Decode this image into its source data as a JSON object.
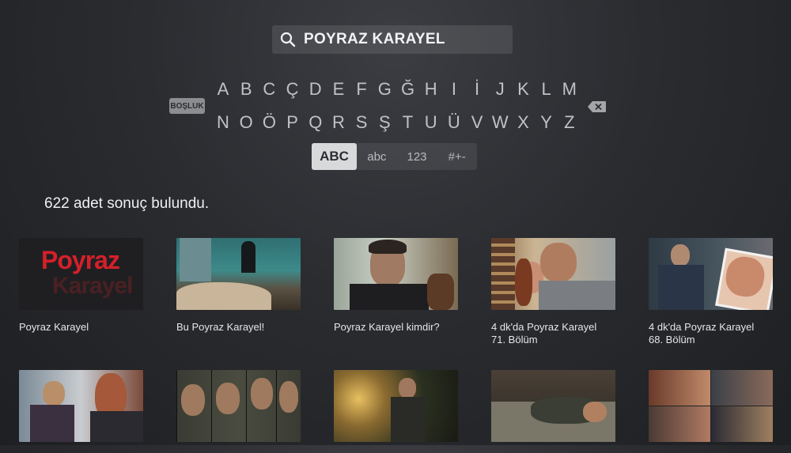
{
  "search": {
    "query": "POYRAZ KARAYEL"
  },
  "keyboard": {
    "row1": [
      "A",
      "B",
      "C",
      "Ç",
      "D",
      "E",
      "F",
      "G",
      "Ğ",
      "H",
      "I",
      "İ",
      "J",
      "K",
      "L",
      "M"
    ],
    "row2": [
      "N",
      "O",
      "Ö",
      "P",
      "Q",
      "R",
      "S",
      "Ş",
      "T",
      "U",
      "Ü",
      "V",
      "W",
      "X",
      "Y",
      "Z"
    ],
    "space_label": "BOŞLUK",
    "delete_icon": "backspace-icon",
    "modes": [
      {
        "label": "ABC",
        "active": true
      },
      {
        "label": "abc",
        "active": false
      },
      {
        "label": "123",
        "active": false
      },
      {
        "label": "#+-",
        "active": false
      }
    ]
  },
  "results": {
    "count_text": "622 adet sonuç bulundu.",
    "items": [
      {
        "title": "Poyraz Karayel",
        "logo_line1": "Poyraz",
        "logo_line2": "Karayel"
      },
      {
        "title": "Bu Poyraz Karayel!"
      },
      {
        "title": "Poyraz Karayel kimdir?"
      },
      {
        "title": "4 dk'da Poyraz Karayel\n71. Bölüm"
      },
      {
        "title": "4 dk'da Poyraz Karayel\n68. Bölüm"
      },
      {
        "title": ""
      },
      {
        "title": ""
      },
      {
        "title": ""
      },
      {
        "title": ""
      },
      {
        "title": ""
      }
    ]
  },
  "colors": {
    "background": "#2a2c30",
    "active_key": "#d8d9db",
    "logo_red": "#d4202a"
  }
}
